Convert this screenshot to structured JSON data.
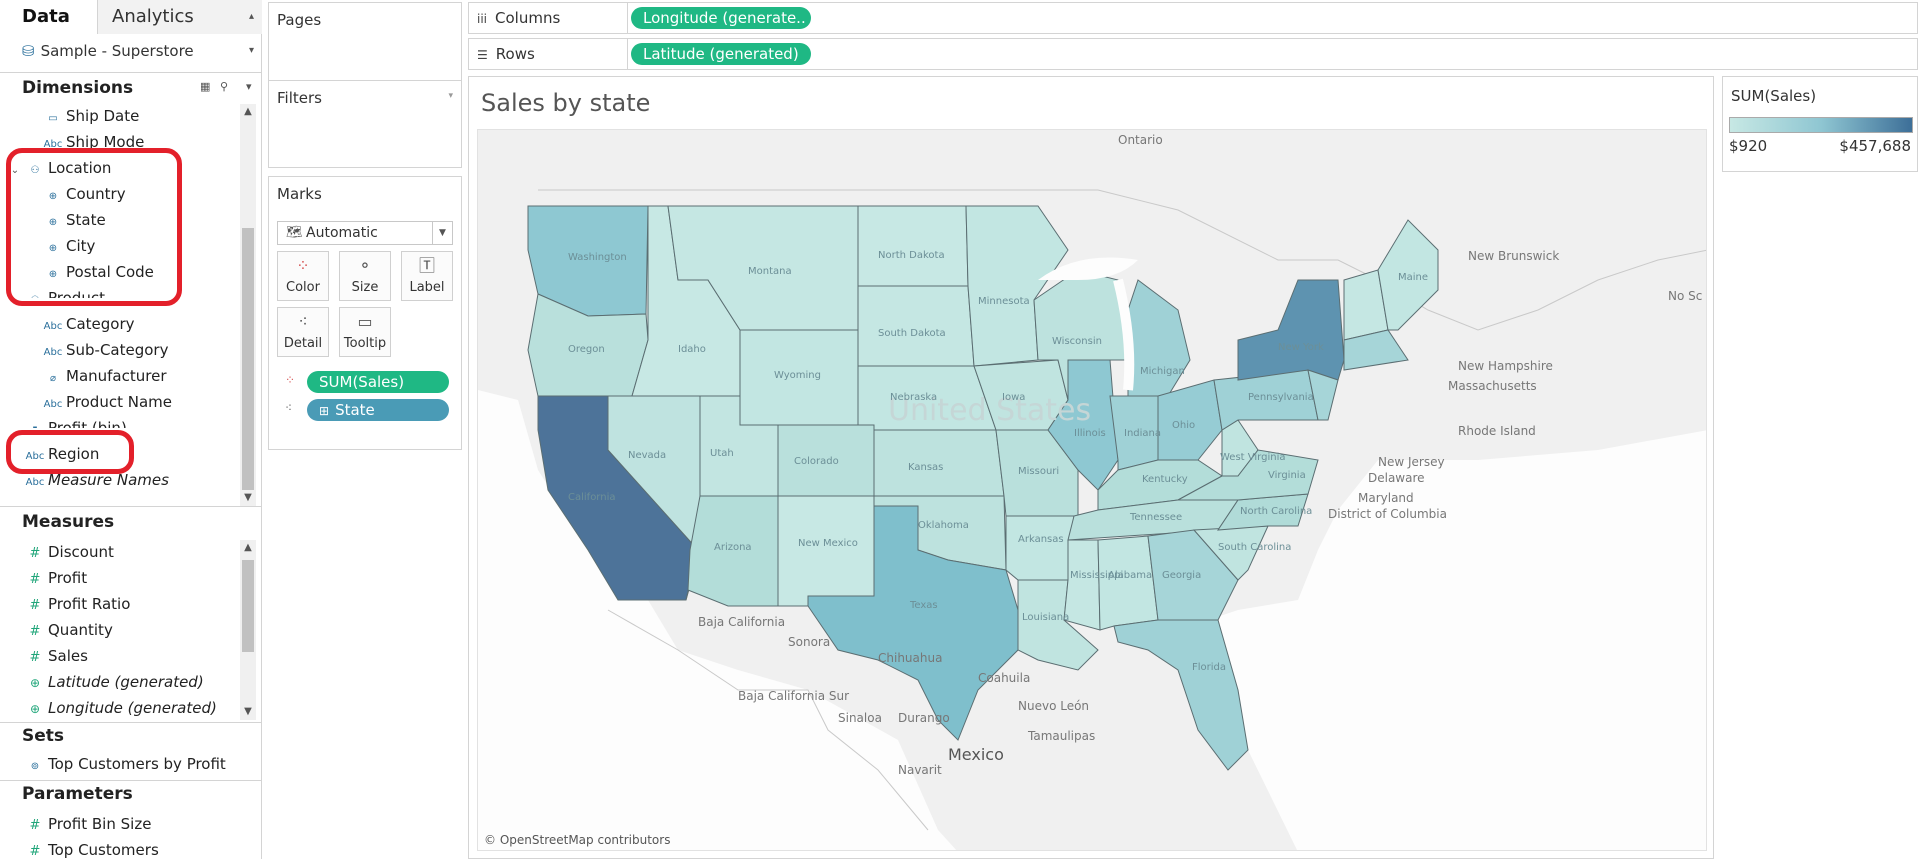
{
  "left_panel": {
    "tab_data": "Data",
    "tab_analytics": "Analytics",
    "datasource": "Sample - Superstore",
    "dimensions_header": "Dimensions",
    "dimensions": [
      {
        "label": "Ship Date",
        "icon": "calendar-icon"
      },
      {
        "label": "Ship Mode",
        "icon": "abc-icon"
      },
      {
        "label": "Location",
        "icon": "hierarchy-icon"
      },
      {
        "label": "Country",
        "icon": "globe-icon"
      },
      {
        "label": "State",
        "icon": "globe-icon"
      },
      {
        "label": "City",
        "icon": "globe-icon"
      },
      {
        "label": "Postal Code",
        "icon": "globe-icon"
      },
      {
        "label": "Product",
        "icon": "hierarchy-icon"
      },
      {
        "label": "Category",
        "icon": "abc-icon"
      },
      {
        "label": "Sub-Category",
        "icon": "abc-icon"
      },
      {
        "label": "Manufacturer",
        "icon": "paperclip-icon"
      },
      {
        "label": "Product Name",
        "icon": "abc-icon"
      },
      {
        "label": "Profit (bin)",
        "icon": "histogram-icon"
      },
      {
        "label": "Region",
        "icon": "abc-icon"
      },
      {
        "label": "Measure Names",
        "icon": "abc-icon"
      }
    ],
    "measures_header": "Measures",
    "measures": [
      {
        "label": "Discount",
        "icon": "hash-icon"
      },
      {
        "label": "Profit",
        "icon": "hash-icon"
      },
      {
        "label": "Profit Ratio",
        "icon": "hash-icon"
      },
      {
        "label": "Quantity",
        "icon": "hash-icon"
      },
      {
        "label": "Sales",
        "icon": "hash-icon"
      },
      {
        "label": "Latitude (generated)",
        "icon": "globe-icon"
      },
      {
        "label": "Longitude (generated)",
        "icon": "globe-icon"
      }
    ],
    "sets_header": "Sets",
    "sets": [
      {
        "label": "Top Customers by Profit",
        "icon": "set-icon"
      }
    ],
    "parameters_header": "Parameters",
    "parameters": [
      {
        "label": "Profit Bin Size",
        "icon": "hash-icon"
      },
      {
        "label": "Top Customers",
        "icon": "hash-icon"
      }
    ]
  },
  "cards": {
    "pages": "Pages",
    "filters": "Filters",
    "marks": "Marks",
    "mark_type": "Automatic",
    "buttons": {
      "color": "Color",
      "size": "Size",
      "label": "Label",
      "detail": "Detail",
      "tooltip": "Tooltip"
    },
    "mark_pills": {
      "sales": "SUM(Sales)",
      "state": "State"
    }
  },
  "shelves": {
    "columns_label": "Columns",
    "columns_pill": "Longitude (generate..",
    "rows_label": "Rows",
    "rows_pill": "Latitude (generated)"
  },
  "viz": {
    "title": "Sales by state",
    "attribution": "© OpenStreetMap contributors",
    "map_labels": {
      "ontario": "Ontario",
      "new_brunswick": "New Brunswick",
      "nova_scotia": "No Sc",
      "new_hampshire": "New Hampshire",
      "massachusetts": "Massachusetts",
      "rhode_island": "Rhode Island",
      "new_jersey": "New Jersey",
      "delaware": "Delaware",
      "maryland": "Maryland",
      "dc": "District of Columbia",
      "baja": "Baja California",
      "sonora": "Sonora",
      "chihuahua": "Chihuahua",
      "coahuila": "Coahuila",
      "baja_sur": "Baja California Sur",
      "sinaloa": "Sinaloa",
      "durango": "Durango",
      "nuevo_leon": "Nuevo León",
      "tamaulipas": "Tamaulipas",
      "mexico": "Mexico",
      "navarit": "Navarit",
      "us_watermark": "United States",
      "washington": "Washington",
      "oregon": "Oregon",
      "idaho": "Idaho",
      "montana": "Montana",
      "wyoming": "Wyoming",
      "california": "California",
      "nevada": "Nevada",
      "utah": "Utah",
      "colorado": "Colorado",
      "arizona": "Arizona",
      "new_mexico": "New Mexico",
      "north_dakota": "North Dakota",
      "south_dakota": "South Dakota",
      "nebraska": "Nebraska",
      "kansas": "Kansas",
      "oklahoma": "Oklahoma",
      "texas": "Texas",
      "minnesota": "Minnesota",
      "iowa": "Iowa",
      "missouri": "Missouri",
      "arkansas": "Arkansas",
      "louisiana": "Louisiana",
      "wisconsin": "Wisconsin",
      "illinois": "Illinois",
      "michigan": "Michigan",
      "indiana": "Indiana",
      "ohio": "Ohio",
      "kentucky": "Kentucky",
      "tennessee": "Tennessee",
      "mississippi": "Mississippi",
      "alabama": "Alabama",
      "georgia": "Georgia",
      "florida": "Florida",
      "south_carolina": "South Carolina",
      "north_carolina": "North Carolina",
      "virginia": "Virginia",
      "west_virginia": "West Virginia",
      "pennsylvania": "Pennsylvania",
      "new_york": "New York",
      "maine": "Maine"
    }
  },
  "legend": {
    "title": "SUM(Sales)",
    "min": "$920",
    "max": "$457,688"
  },
  "colors": {
    "tableau_green": "#1fb884",
    "tableau_blue": "#4a9bb6",
    "highlight_red": "#e3202a",
    "ramp_low": "#c7e8e4",
    "ramp_high": "#3d6f98"
  }
}
